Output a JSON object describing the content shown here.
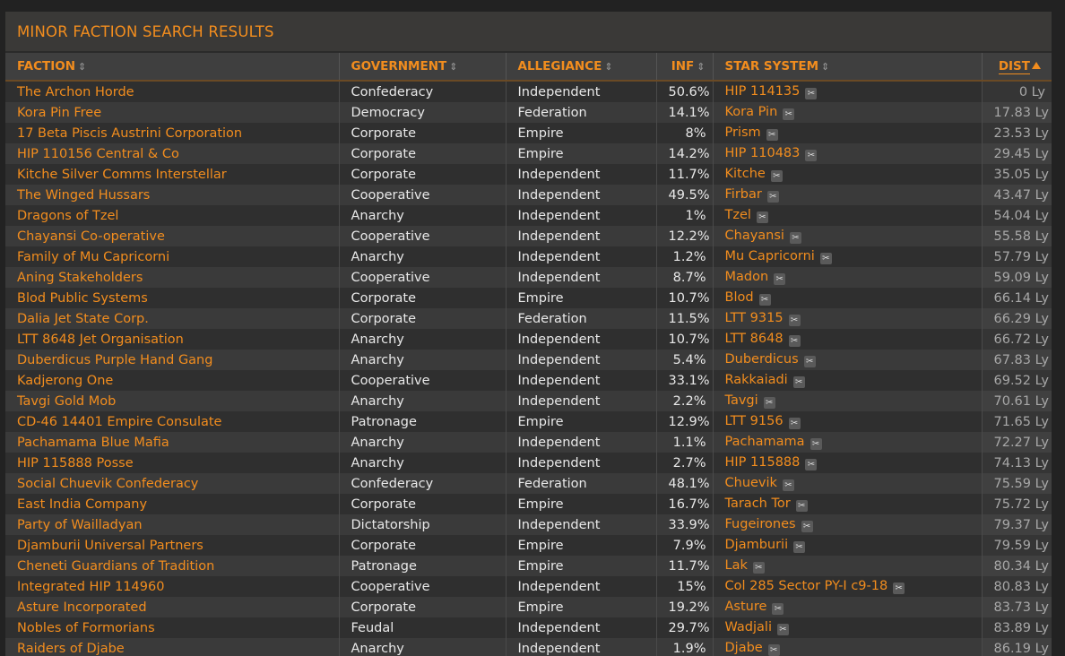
{
  "panel": {
    "title": "MINOR FACTION SEARCH RESULTS"
  },
  "columns": {
    "faction": "FACTION",
    "government": "GOVERNMENT",
    "allegiance": "ALLEGIANCE",
    "inf": "INF",
    "star_system": "STAR SYSTEM",
    "dist": "DIST",
    "sort_glyph": "⇕"
  },
  "colors": {
    "accent": "#f28d1e",
    "background": "#222222",
    "row_odd": "#2f2f2f",
    "row_even": "#3a3a3a"
  },
  "icons": {
    "sortable": "sort-icon",
    "sorted_asc": "sort-ascending-icon",
    "copy": "scissors-copy-icon",
    "copy_glyph": "✂"
  },
  "rows": [
    {
      "faction": "The Archon Horde",
      "government": "Confederacy",
      "allegiance": "Independent",
      "inf": "50.6%",
      "system": "HIP 114135",
      "dist": "0 Ly"
    },
    {
      "faction": "Kora Pin Free",
      "government": "Democracy",
      "allegiance": "Federation",
      "inf": "14.1%",
      "system": "Kora Pin",
      "dist": "17.83 Ly"
    },
    {
      "faction": "17 Beta Piscis Austrini Corporation",
      "government": "Corporate",
      "allegiance": "Empire",
      "inf": "8%",
      "system": "Prism",
      "dist": "23.53 Ly"
    },
    {
      "faction": "HIP 110156 Central & Co",
      "government": "Corporate",
      "allegiance": "Empire",
      "inf": "14.2%",
      "system": "HIP 110483",
      "dist": "29.45 Ly"
    },
    {
      "faction": "Kitche Silver Comms Interstellar",
      "government": "Corporate",
      "allegiance": "Independent",
      "inf": "11.7%",
      "system": "Kitche",
      "dist": "35.05 Ly"
    },
    {
      "faction": "The Winged Hussars",
      "government": "Cooperative",
      "allegiance": "Independent",
      "inf": "49.5%",
      "system": "Firbar",
      "dist": "43.47 Ly"
    },
    {
      "faction": "Dragons of Tzel",
      "government": "Anarchy",
      "allegiance": "Independent",
      "inf": "1%",
      "system": "Tzel",
      "dist": "54.04 Ly"
    },
    {
      "faction": "Chayansi Co-operative",
      "government": "Cooperative",
      "allegiance": "Independent",
      "inf": "12.2%",
      "system": "Chayansi",
      "dist": "55.58 Ly"
    },
    {
      "faction": "Family of Mu Capricorni",
      "government": "Anarchy",
      "allegiance": "Independent",
      "inf": "1.2%",
      "system": "Mu Capricorni",
      "dist": "57.79 Ly"
    },
    {
      "faction": "Aning Stakeholders",
      "government": "Cooperative",
      "allegiance": "Independent",
      "inf": "8.7%",
      "system": "Madon",
      "dist": "59.09 Ly"
    },
    {
      "faction": "Blod Public Systems",
      "government": "Corporate",
      "allegiance": "Empire",
      "inf": "10.7%",
      "system": "Blod",
      "dist": "66.14 Ly"
    },
    {
      "faction": "Dalia Jet State Corp.",
      "government": "Corporate",
      "allegiance": "Federation",
      "inf": "11.5%",
      "system": "LTT 9315",
      "dist": "66.29 Ly"
    },
    {
      "faction": "LTT 8648 Jet Organisation",
      "government": "Anarchy",
      "allegiance": "Independent",
      "inf": "10.7%",
      "system": "LTT 8648",
      "dist": "66.72 Ly"
    },
    {
      "faction": "Duberdicus Purple Hand Gang",
      "government": "Anarchy",
      "allegiance": "Independent",
      "inf": "5.4%",
      "system": "Duberdicus",
      "dist": "67.83 Ly"
    },
    {
      "faction": "Kadjerong One",
      "government": "Cooperative",
      "allegiance": "Independent",
      "inf": "33.1%",
      "system": "Rakkaiadi",
      "dist": "69.52 Ly"
    },
    {
      "faction": "Tavgi Gold Mob",
      "government": "Anarchy",
      "allegiance": "Independent",
      "inf": "2.2%",
      "system": "Tavgi",
      "dist": "70.61 Ly"
    },
    {
      "faction": "CD-46 14401 Empire Consulate",
      "government": "Patronage",
      "allegiance": "Empire",
      "inf": "12.9%",
      "system": "LTT 9156",
      "dist": "71.65 Ly"
    },
    {
      "faction": "Pachamama Blue Mafia",
      "government": "Anarchy",
      "allegiance": "Independent",
      "inf": "1.1%",
      "system": "Pachamama",
      "dist": "72.27 Ly"
    },
    {
      "faction": "HIP 115888 Posse",
      "government": "Anarchy",
      "allegiance": "Independent",
      "inf": "2.7%",
      "system": "HIP 115888",
      "dist": "74.13 Ly"
    },
    {
      "faction": "Social Chuevik Confederacy",
      "government": "Confederacy",
      "allegiance": "Federation",
      "inf": "48.1%",
      "system": "Chuevik",
      "dist": "75.59 Ly"
    },
    {
      "faction": "East India Company",
      "government": "Corporate",
      "allegiance": "Empire",
      "inf": "16.7%",
      "system": "Tarach Tor",
      "dist": "75.72 Ly"
    },
    {
      "faction": "Party of Wailladyan",
      "government": "Dictatorship",
      "allegiance": "Independent",
      "inf": "33.9%",
      "system": "Fugeirones",
      "dist": "79.37 Ly"
    },
    {
      "faction": "Djamburii Universal Partners",
      "government": "Corporate",
      "allegiance": "Empire",
      "inf": "7.9%",
      "system": "Djamburii",
      "dist": "79.59 Ly"
    },
    {
      "faction": "Cheneti Guardians of Tradition",
      "government": "Patronage",
      "allegiance": "Empire",
      "inf": "11.7%",
      "system": "Lak",
      "dist": "80.34 Ly"
    },
    {
      "faction": "Integrated HIP 114960",
      "government": "Cooperative",
      "allegiance": "Independent",
      "inf": "15%",
      "system": "Col 285 Sector PY-I c9-18",
      "dist": "80.83 Ly"
    },
    {
      "faction": "Asture Incorporated",
      "government": "Corporate",
      "allegiance": "Empire",
      "inf": "19.2%",
      "system": "Asture",
      "dist": "83.73 Ly"
    },
    {
      "faction": "Nobles of Formorians",
      "government": "Feudal",
      "allegiance": "Independent",
      "inf": "29.7%",
      "system": "Wadjali",
      "dist": "83.89 Ly"
    },
    {
      "faction": "Raiders of Djabe",
      "government": "Anarchy",
      "allegiance": "Independent",
      "inf": "1.9%",
      "system": "Djabe",
      "dist": "86.19 Ly"
    }
  ]
}
